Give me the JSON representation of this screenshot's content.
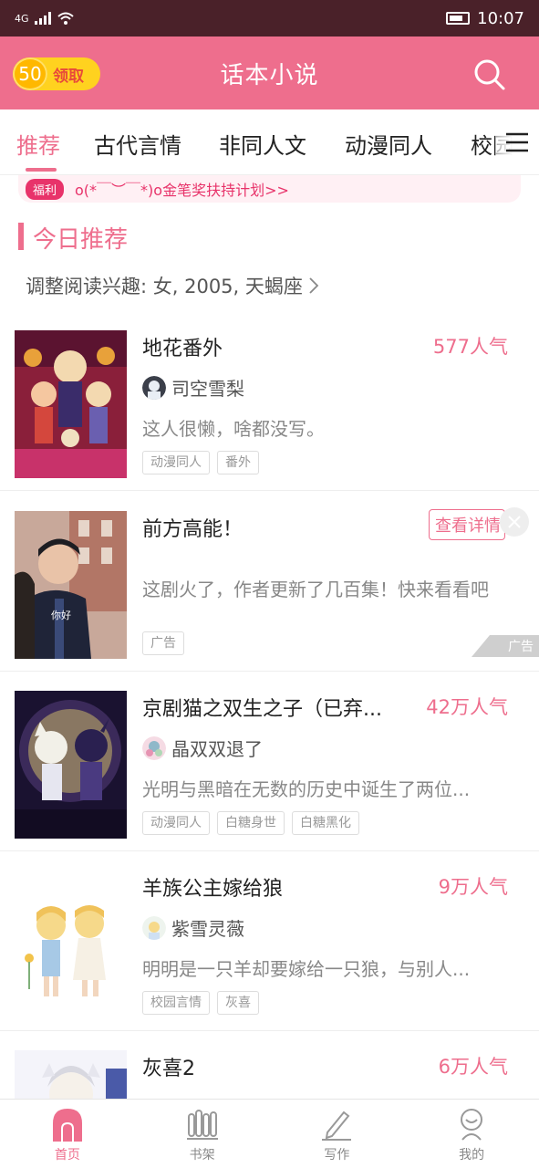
{
  "status_bar": {
    "network": "4G",
    "time": "10:07"
  },
  "header": {
    "title": "话本小说",
    "coin_count": "50",
    "coin_label": "领取"
  },
  "tabs": [
    {
      "label": "推荐",
      "active": true
    },
    {
      "label": "古代言情",
      "active": false
    },
    {
      "label": "非同人文",
      "active": false
    },
    {
      "label": "动漫同人",
      "active": false
    },
    {
      "label": "校园",
      "active": false
    }
  ],
  "promo": {
    "tag": "福利",
    "text": "o(*￣︶￣*)o金笔奖扶持计划>>"
  },
  "section": {
    "title": "今日推荐",
    "interest": "调整阅读兴趣: 女, 2005, 天蝎座"
  },
  "books": [
    {
      "title": "地花番外",
      "popularity": "577人气",
      "author": "司空雪梨",
      "desc": "这人很懒，啥都没写。",
      "tags": [
        "动漫同人",
        "番外"
      ]
    },
    {
      "title": "前方高能！",
      "desc": "这剧火了，作者更新了几百集！快来看看吧",
      "button": "查看详情",
      "tag": "广告",
      "ad_label": "广告",
      "cover_caption": "你好"
    },
    {
      "title": "京剧猫之双生之子（已弃...",
      "popularity": "42万人气",
      "author": "晶双双退了",
      "desc": "光明与黑暗在无数的历史中诞生了两位...",
      "tags": [
        "动漫同人",
        "白糖身世",
        "白糖黑化"
      ]
    },
    {
      "title": "羊族公主嫁给狼",
      "popularity": "9万人气",
      "author": "紫雪灵薇",
      "desc": "明明是一只羊却要嫁给一只狼，与别人...",
      "tags": [
        "校园言情",
        "灰喜"
      ]
    },
    {
      "title": "灰喜2",
      "popularity": "6万人气"
    }
  ],
  "bottom_nav": [
    {
      "label": "首页",
      "icon": "home-icon",
      "active": true
    },
    {
      "label": "书架",
      "icon": "bookshelf-icon",
      "active": false
    },
    {
      "label": "写作",
      "icon": "pen-icon",
      "active": false
    },
    {
      "label": "我的",
      "icon": "profile-icon",
      "active": false
    }
  ],
  "colors": {
    "accent": "#ee6e8d",
    "status_bar": "#4a2129",
    "coin": "#ffd21f"
  }
}
